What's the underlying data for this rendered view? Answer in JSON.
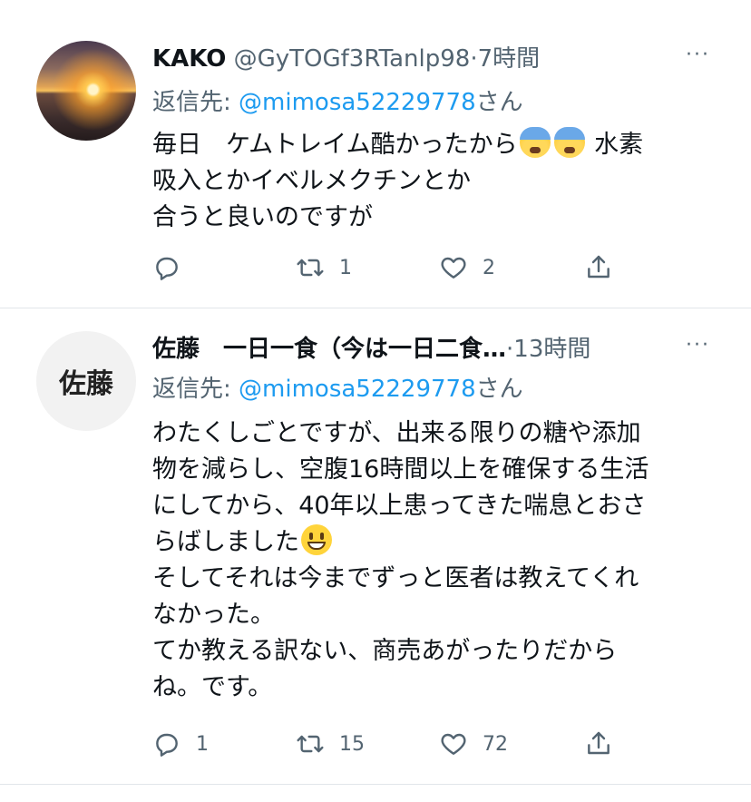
{
  "tweets": [
    {
      "name": "KAKO",
      "handle": "@GyTOGf3RTanlp98",
      "separator": "·",
      "time": "7時間",
      "more": "···",
      "reply_prefix": "返信先: ",
      "reply_mention": "@mimosa52229778",
      "reply_suffix": "さん",
      "body": {
        "line1_a": "毎日　ケムトレイム酷かったから",
        "line1_b": "水素",
        "line2": "吸入とかイベルメクチンとか",
        "line3": "合うと良いのですが"
      },
      "emoji": [
        "fearful-face-with-sweat",
        "fearful-face-with-sweat"
      ],
      "replies": "",
      "retweets": "1",
      "likes": "2"
    },
    {
      "avatar_text": "佐藤",
      "name": "佐藤　一日一食（今は一日二食…",
      "separator": "·",
      "time": "13時間",
      "more": "···",
      "reply_prefix": "返信先: ",
      "reply_mention": "@mimosa52229778",
      "reply_suffix": "さん",
      "body": {
        "line1": "わたくしごとですが、出来る限りの糖や添加",
        "line2": "物を減らし、空腹16時間以上を確保する生活",
        "line3": "にしてから、40年以上患ってきた喘息とおさ",
        "line4": "らばしました",
        "line5": "そしてそれは今までずっと医者は教えてくれ",
        "line6": "なかった。",
        "line7": "てか教える訳ない、商売あがったりだから",
        "line8": "ね。です。"
      },
      "emoji": [
        "grinning-face"
      ],
      "replies": "1",
      "retweets": "15",
      "likes": "72"
    }
  ],
  "colors": {
    "text": "#0f1419",
    "secondary": "#536471",
    "link": "#1d9bf0",
    "divider": "#e1e6ea"
  }
}
